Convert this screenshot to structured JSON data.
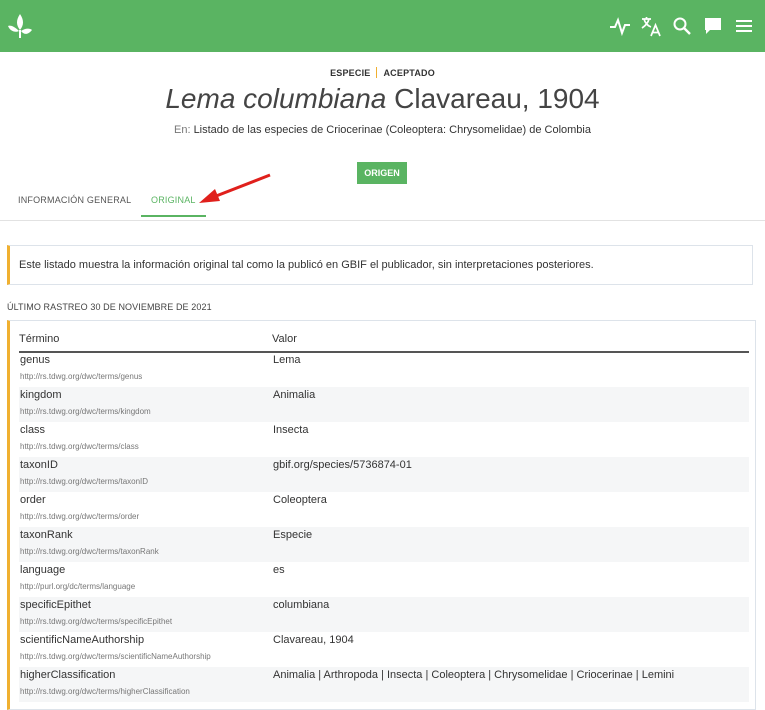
{
  "topbar": {
    "logo_icon": "gbif-leaf-icon",
    "icons": [
      "pulse-icon",
      "translate-icon",
      "search-icon",
      "feedback-icon",
      "menu-icon"
    ],
    "bg_color": "#5ab462"
  },
  "header": {
    "rank": "ESPECIE",
    "status": "ACEPTADO",
    "title_italic": "Lema columbiana",
    "title_authorship": " Clavareau, 1904",
    "in_prefix": "En:",
    "dataset": "Listado de las especies de Criocerinae (Coleoptera: Chrysomelidae) de Colombia",
    "origin_button": "ORIGEN"
  },
  "tabs": [
    {
      "label": "INFORMACIÓN GENERAL",
      "active": false
    },
    {
      "label": "ORIGINAL",
      "active": true
    }
  ],
  "notice": "Este listado muestra la información original tal como la publicó en GBIF el publicador, sin interpretaciones posteriores.",
  "crawl_info": "ÚLTIMO RASTREO 30 DE NOVIEMBRE DE 2021",
  "table": {
    "col_term": "Término",
    "col_value": "Valor",
    "rows": [
      {
        "term": "genus",
        "uri": "http://rs.tdwg.org/dwc/terms/genus",
        "value": "Lema"
      },
      {
        "term": "kingdom",
        "uri": "http://rs.tdwg.org/dwc/terms/kingdom",
        "value": "Animalia"
      },
      {
        "term": "class",
        "uri": "http://rs.tdwg.org/dwc/terms/class",
        "value": "Insecta"
      },
      {
        "term": "taxonID",
        "uri": "http://rs.tdwg.org/dwc/terms/taxonID",
        "value": "gbif.org/species/5736874-01"
      },
      {
        "term": "order",
        "uri": "http://rs.tdwg.org/dwc/terms/order",
        "value": "Coleoptera"
      },
      {
        "term": "taxonRank",
        "uri": "http://rs.tdwg.org/dwc/terms/taxonRank",
        "value": "Especie"
      },
      {
        "term": "language",
        "uri": "http://purl.org/dc/terms/language",
        "value": "es"
      },
      {
        "term": "specificEpithet",
        "uri": "http://rs.tdwg.org/dwc/terms/specificEpithet",
        "value": "columbiana"
      },
      {
        "term": "scientificNameAuthorship",
        "uri": "http://rs.tdwg.org/dwc/terms/scientificNameAuthorship",
        "value": "Clavareau, 1904"
      },
      {
        "term": "higherClassification",
        "uri": "http://rs.tdwg.org/dwc/terms/higherClassification",
        "value": "Animalia | Arthropoda | Insecta | Coleoptera | Chrysomelidae | Criocerinae | Lemini"
      }
    ]
  },
  "accent_colors": {
    "green": "#5ab462",
    "orange": "#f0b030",
    "arrow": "#e0201c"
  }
}
